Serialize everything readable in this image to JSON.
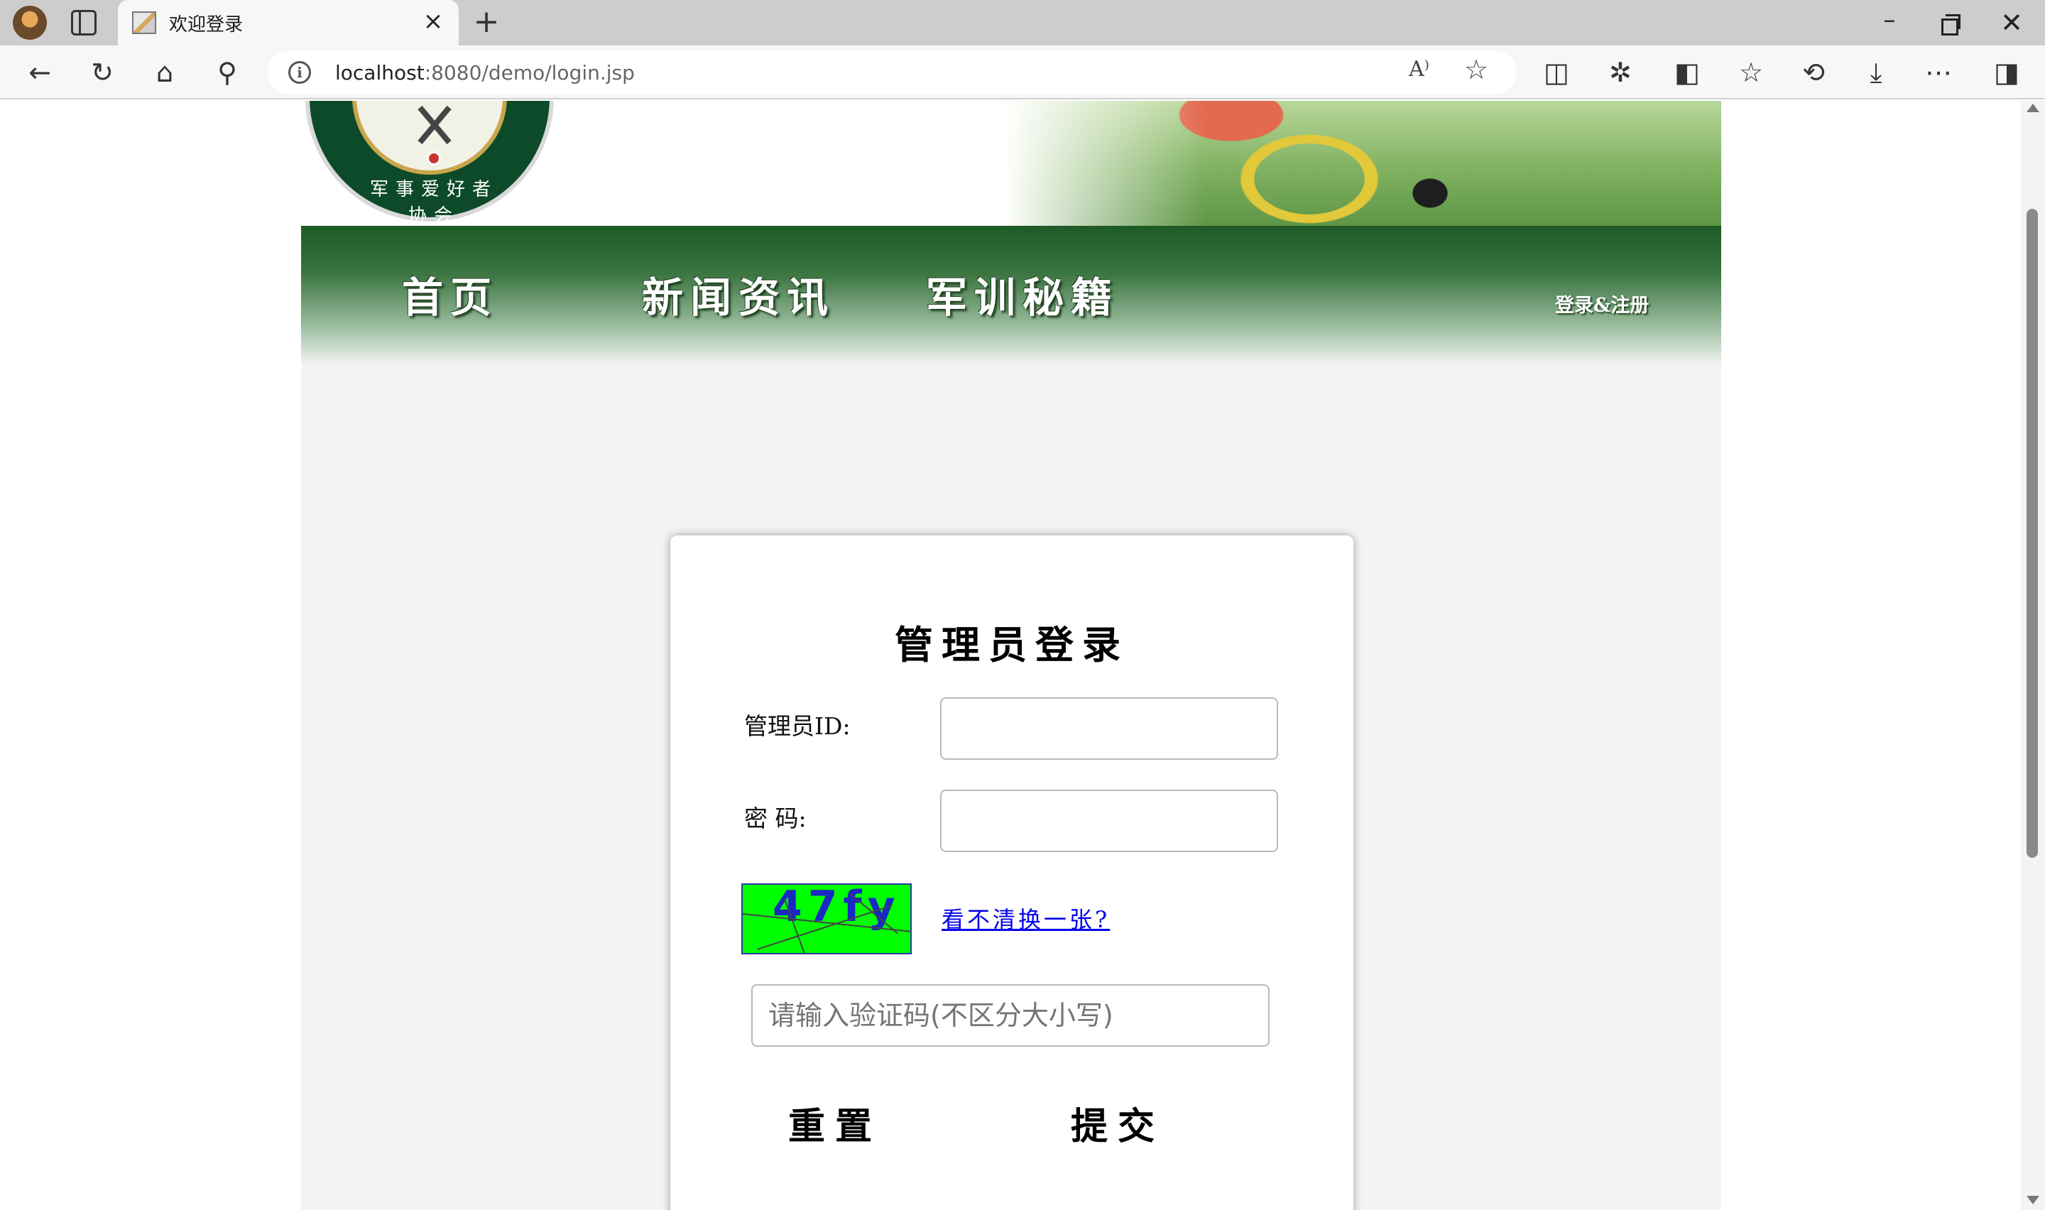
{
  "browser": {
    "tab_title": "欢迎登录",
    "url_host": "localhost",
    "url_path": ":8080/demo/login.jsp",
    "read_aloud_glyph": "A⁾"
  },
  "site": {
    "logo_text": "军事爱好者协会",
    "nav": {
      "home": "首页",
      "news": "新闻资讯",
      "training": "军训秘籍",
      "login_register": "登录&注册"
    }
  },
  "login": {
    "title": "管理员登录",
    "id_label": "管理员ID:",
    "password_label": "密  码:",
    "id_value": "",
    "password_value": "",
    "captcha_text": "47fy",
    "refresh_link": "看不清换一张?",
    "code_placeholder": "请输入验证码(不区分大小写)",
    "reset_label": "重置",
    "submit_label": "提交"
  },
  "colors": {
    "nav_green": "#1e5a26",
    "captcha_bg": "#00ff00",
    "captcha_text": "#1b28c4",
    "link": "#0000ee"
  }
}
